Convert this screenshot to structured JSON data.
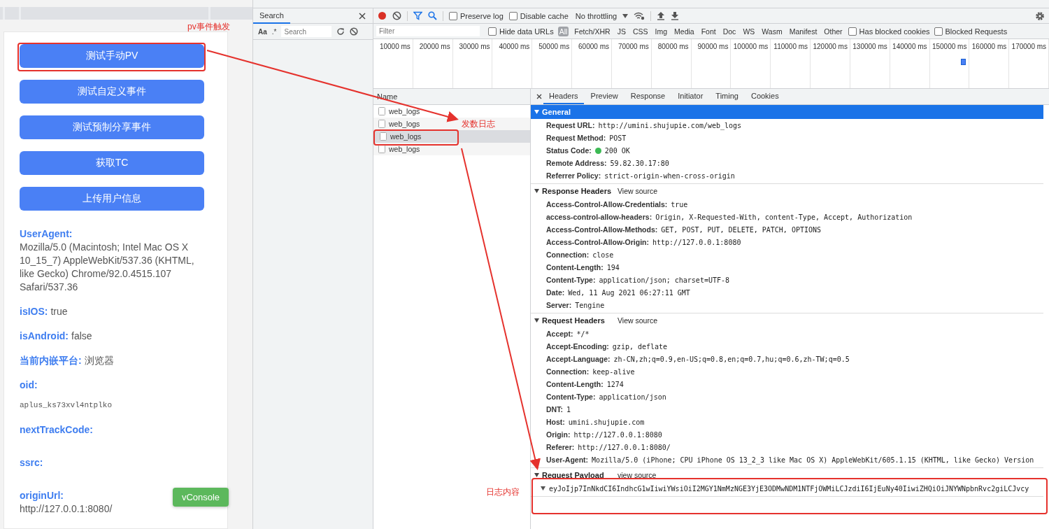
{
  "phone": {
    "buttons": [
      {
        "label": "测试手动PV"
      },
      {
        "label": "测试自定义事件"
      },
      {
        "label": "测试预制分享事件"
      },
      {
        "label": "获取TC"
      },
      {
        "label": "上传用户信息"
      }
    ],
    "info": [
      {
        "kind": "block",
        "label": "UserAgent:",
        "value": "Mozilla/5.0 (Macintosh; Intel Mac OS X 10_15_7) AppleWebKit/537.36 (KHTML, like Gecko) Chrome/92.0.4515.107 Safari/537.36"
      },
      {
        "kind": "inline",
        "label": "isIOS:",
        "value": "true"
      },
      {
        "kind": "inline",
        "label": "isAndroid:",
        "value": "false"
      },
      {
        "kind": "inline",
        "label": "当前内嵌平台:",
        "value": "浏览器"
      },
      {
        "kind": "code",
        "label": "oid:",
        "value": "aplus_ks73xvl4ntplko"
      },
      {
        "kind": "block",
        "label": "nextTrackCode:"
      },
      {
        "kind": "block",
        "label": "ssrc:"
      },
      {
        "kind": "block",
        "label": "originUrl:",
        "value": "http://127.0.0.1:8080/"
      }
    ],
    "vconsole": "vConsole"
  },
  "search_panel": {
    "title": "Search",
    "case_toggle": "Aa",
    "regex_toggle": ".*",
    "placeholder": "Search"
  },
  "network": {
    "toolbar": {
      "recording": true,
      "preserve_log": {
        "label": "Preserve log",
        "checked": false
      },
      "disable_cache": {
        "label": "Disable cache",
        "checked": false
      },
      "throttling": "No throttling"
    },
    "filter": {
      "placeholder": "Filter",
      "hide_data_urls": {
        "label": "Hide data URLs",
        "checked": false
      },
      "types": [
        {
          "label": "All",
          "selected": true
        },
        {
          "label": "Fetch/XHR",
          "selected": false
        },
        {
          "label": "JS",
          "selected": false
        },
        {
          "label": "CSS",
          "selected": false
        },
        {
          "label": "Img",
          "selected": false
        },
        {
          "label": "Media",
          "selected": false
        },
        {
          "label": "Font",
          "selected": false
        },
        {
          "label": "Doc",
          "selected": false
        },
        {
          "label": "WS",
          "selected": false
        },
        {
          "label": "Wasm",
          "selected": false
        },
        {
          "label": "Manifest",
          "selected": false
        },
        {
          "label": "Other",
          "selected": false
        }
      ],
      "has_blocked_cookies": {
        "label": "Has blocked cookies",
        "checked": false
      },
      "blocked_requests": {
        "label": "Blocked Requests",
        "checked": false
      }
    },
    "timeline_ticks": [
      "10000 ms",
      "20000 ms",
      "30000 ms",
      "40000 ms",
      "50000 ms",
      "60000 ms",
      "70000 ms",
      "80000 ms",
      "90000 ms",
      "100000 ms",
      "110000 ms",
      "120000 ms",
      "130000 ms",
      "140000 ms",
      "150000 ms",
      "160000 ms",
      "170000 ms"
    ],
    "requests": {
      "column": "Name",
      "rows": [
        {
          "name": "web_logs",
          "selected": false
        },
        {
          "name": "web_logs",
          "selected": false
        },
        {
          "name": "web_logs",
          "selected": true
        },
        {
          "name": "web_logs",
          "selected": false
        }
      ]
    },
    "detail_tabs": [
      {
        "label": "Headers",
        "selected": true
      },
      {
        "label": "Preview",
        "selected": false
      },
      {
        "label": "Response",
        "selected": false
      },
      {
        "label": "Initiator",
        "selected": false
      },
      {
        "label": "Timing",
        "selected": false
      },
      {
        "label": "Cookies",
        "selected": false
      }
    ],
    "sections": [
      {
        "title": "General",
        "expanded": true,
        "highlighted": true,
        "rows": [
          {
            "kind": "plain",
            "key": "Request URL:",
            "value": "http://umini.shujupie.com/web_logs"
          },
          {
            "kind": "plain",
            "key": "Request Method:",
            "value": "POST"
          },
          {
            "kind": "status",
            "key": "Status Code:",
            "value": "200 OK"
          },
          {
            "kind": "plain",
            "key": "Remote Address:",
            "value": "59.82.30.17:80"
          },
          {
            "kind": "plain",
            "key": "Referrer Policy:",
            "value": "strict-origin-when-cross-origin"
          }
        ]
      },
      {
        "title": "Response Headers",
        "link": "View source",
        "expanded": true,
        "highlighted": false,
        "rows": [
          {
            "kind": "plain",
            "key": "Access-Control-Allow-Credentials:",
            "value": "true"
          },
          {
            "kind": "plain",
            "key": "access-control-allow-headers:",
            "value": "Origin, X-Requested-With, content-Type, Accept, Authorization"
          },
          {
            "kind": "plain",
            "key": "Access-Control-Allow-Methods:",
            "value": "GET, POST, PUT, DELETE, PATCH, OPTIONS"
          },
          {
            "kind": "plain",
            "key": "Access-Control-Allow-Origin:",
            "value": "http://127.0.0.1:8080"
          },
          {
            "kind": "plain",
            "key": "Connection:",
            "value": "close"
          },
          {
            "kind": "plain",
            "key": "Content-Length:",
            "value": "194"
          },
          {
            "kind": "plain",
            "key": "Content-Type:",
            "value": "application/json; charset=UTF-8"
          },
          {
            "kind": "plain",
            "key": "Date:",
            "value": "Wed, 11 Aug 2021 06:27:11 GMT"
          },
          {
            "kind": "plain",
            "key": "Server:",
            "value": "Tengine"
          }
        ]
      },
      {
        "title": "Request Headers",
        "link": "View source",
        "expanded": true,
        "highlighted": false,
        "rows": [
          {
            "kind": "plain",
            "key": "Accept:",
            "value": "*/*"
          },
          {
            "kind": "plain",
            "key": "Accept-Encoding:",
            "value": "gzip, deflate"
          },
          {
            "kind": "plain",
            "key": "Accept-Language:",
            "value": "zh-CN,zh;q=0.9,en-US;q=0.8,en;q=0.7,hu;q=0.6,zh-TW;q=0.5"
          },
          {
            "kind": "plain",
            "key": "Connection:",
            "value": "keep-alive"
          },
          {
            "kind": "plain",
            "key": "Content-Length:",
            "value": "1274"
          },
          {
            "kind": "plain",
            "key": "Content-Type:",
            "value": "application/json"
          },
          {
            "kind": "plain",
            "key": "DNT:",
            "value": "1"
          },
          {
            "kind": "plain",
            "key": "Host:",
            "value": "umini.shujupie.com"
          },
          {
            "kind": "plain",
            "key": "Origin:",
            "value": "http://127.0.0.1:8080"
          },
          {
            "kind": "plain",
            "key": "Referer:",
            "value": "http://127.0.0.1:8080/"
          },
          {
            "kind": "plain",
            "key": "User-Agent:",
            "value": "Mozilla/5.0 (iPhone; CPU iPhone OS 13_2_3 like Mac OS X) AppleWebKit/605.1.15 (KHTML, like Gecko) Version"
          }
        ]
      },
      {
        "title": "Request Payload",
        "link": "view source",
        "expanded": true,
        "highlighted": false,
        "rows": [
          {
            "kind": "payload",
            "value": "eyJoIjp7InNkdCI6IndhcG1wIiwiYWsiOiI2MGY1NmMzNGE3YjE3ODMwNDM1NTFjOWMiLCJzdiI6IjEuNy40IiwiZHQiOiJNYWNpbnRvc2giLCJvcy"
          }
        ]
      }
    ]
  },
  "annotations": [
    {
      "text": "pv事件触发"
    },
    {
      "text": "发数日志"
    },
    {
      "text": "日志内容"
    }
  ]
}
